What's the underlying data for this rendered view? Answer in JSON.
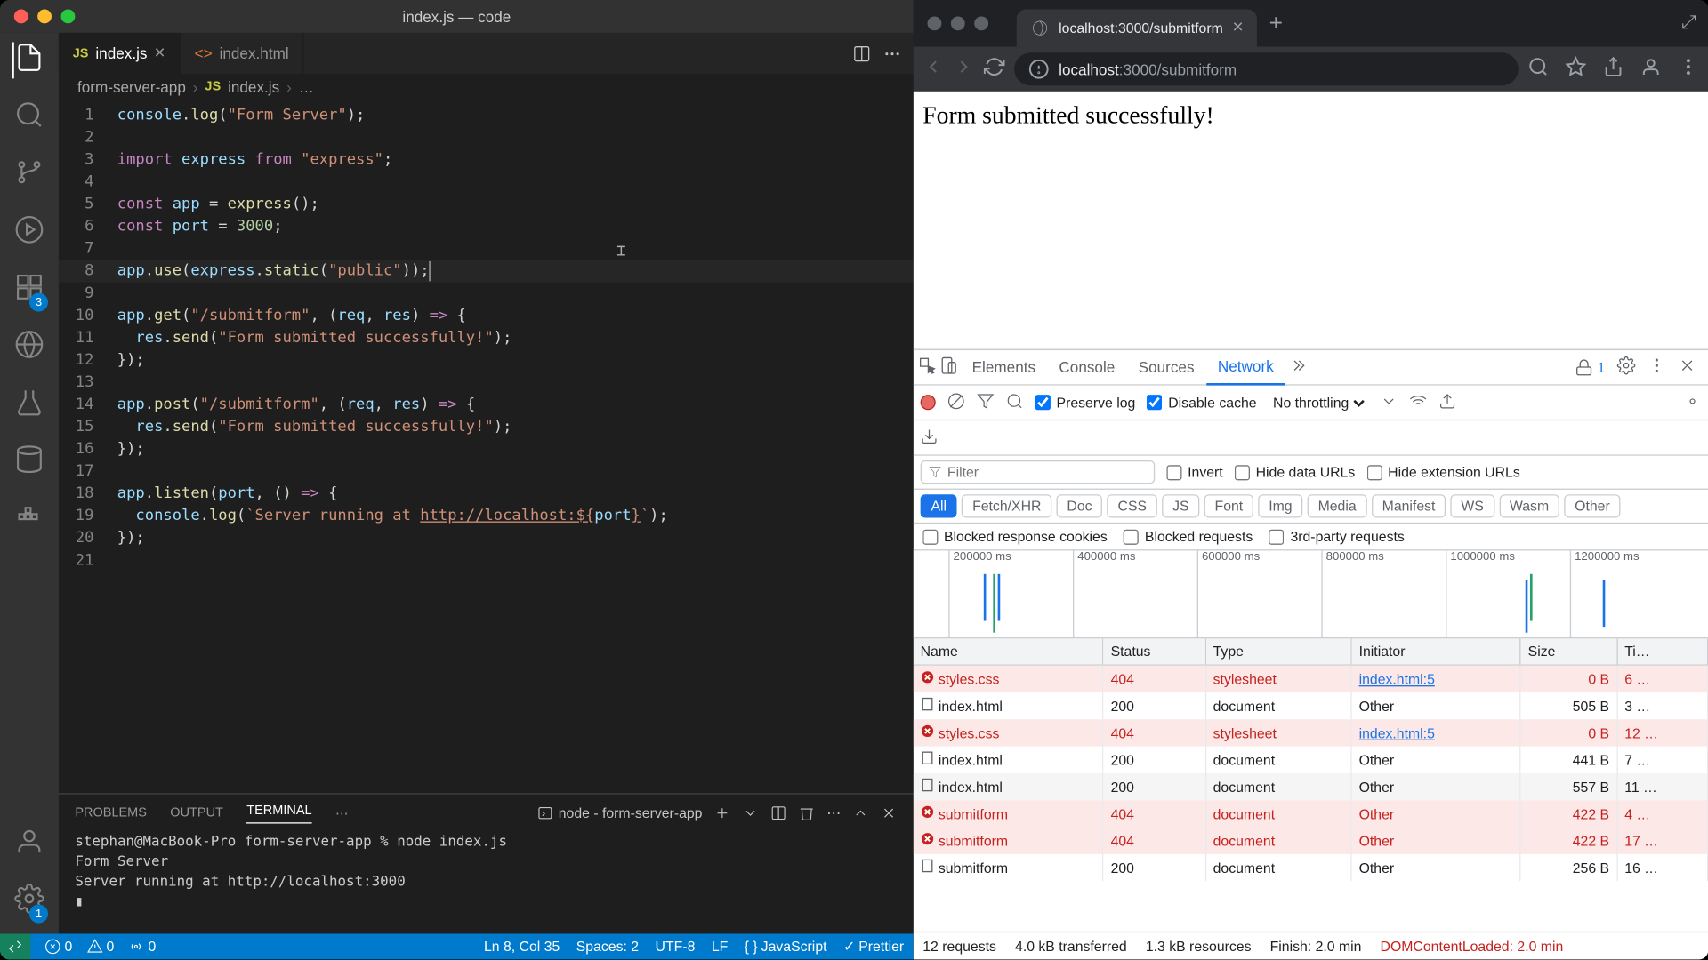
{
  "vscode": {
    "title": "index.js — code",
    "tabs": [
      {
        "icon": "JS",
        "name": "index.js",
        "active": true,
        "close": true
      },
      {
        "icon": "<>",
        "name": "index.html",
        "active": false,
        "close": false
      }
    ],
    "breadcrumbs": {
      "folder": "form-server-app",
      "file_icon": "JS",
      "file": "index.js",
      "member": "…"
    },
    "code_lines": [
      {
        "n": 1,
        "html": "<span class='id'>console</span>.<span class='fn'>log</span>(<span class='str'>\"Form Server\"</span>);"
      },
      {
        "n": 2,
        "html": ""
      },
      {
        "n": 3,
        "html": "<span class='kw'>import</span> <span class='id'>express</span> <span class='kw'>from</span> <span class='str'>\"express\"</span>;"
      },
      {
        "n": 4,
        "html": ""
      },
      {
        "n": 5,
        "html": "<span class='kw'>const</span> <span class='id'>app</span> = <span class='fn'>express</span>();"
      },
      {
        "n": 6,
        "html": "<span class='kw'>const</span> <span class='id'>port</span> = <span class='num'>3000</span>;"
      },
      {
        "n": 7,
        "html": ""
      },
      {
        "n": 8,
        "html": "<span class='id'>app</span>.<span class='fn'>use</span>(<span class='id'>express</span>.<span class='fn'>static</span>(<span class='str'>\"public\"</span>));",
        "current": true
      },
      {
        "n": 9,
        "html": ""
      },
      {
        "n": 10,
        "html": "<span class='id'>app</span>.<span class='fn'>get</span>(<span class='str'>\"/submitform\"</span>, (<span class='id'>req</span>, <span class='id'>res</span>) <span class='kw'>=&gt;</span> {"
      },
      {
        "n": 11,
        "html": "  <span class='id'>res</span>.<span class='fn'>send</span>(<span class='str'>\"Form submitted successfully!\"</span>);"
      },
      {
        "n": 12,
        "html": "});"
      },
      {
        "n": 13,
        "html": ""
      },
      {
        "n": 14,
        "html": "<span class='id'>app</span>.<span class='fn'>post</span>(<span class='str'>\"/submitform\"</span>, (<span class='id'>req</span>, <span class='id'>res</span>) <span class='kw'>=&gt;</span> {"
      },
      {
        "n": 15,
        "html": "  <span class='id'>res</span>.<span class='fn'>send</span>(<span class='str'>\"Form submitted successfully!\"</span>);"
      },
      {
        "n": 16,
        "html": "});"
      },
      {
        "n": 17,
        "html": ""
      },
      {
        "n": 18,
        "html": "<span class='id'>app</span>.<span class='fn'>listen</span>(<span class='id'>port</span>, () <span class='kw'>=&gt;</span> {"
      },
      {
        "n": 19,
        "html": "  <span class='id'>console</span>.<span class='fn'>log</span>(<span class='str'>`Server running at <span class='url'>http://localhost:${</span></span><span class='id'>port</span><span class='str'><span class='url'>}</span>`</span>);"
      },
      {
        "n": 20,
        "html": "});"
      },
      {
        "n": 21,
        "html": ""
      }
    ],
    "activitybar_badges": {
      "scm": "3",
      "settings": "1"
    },
    "panel": {
      "tabs": [
        "PROBLEMS",
        "OUTPUT",
        "TERMINAL"
      ],
      "active_tab": "TERMINAL",
      "terminal_select": "node - form-server-app",
      "terminal_content": "stephan@MacBook-Pro form-server-app % node index.js\nForm Server\nServer running at http://localhost:3000\n▮"
    },
    "statusbar": {
      "errors": "0",
      "warnings": "0",
      "ports": "0",
      "cursor": "Ln 8, Col 35",
      "spaces": "Spaces: 2",
      "encoding": "UTF-8",
      "eol": "LF",
      "lang": "JavaScript",
      "prettier": "Prettier"
    }
  },
  "browser": {
    "tab_title": "localhost:3000/submitform",
    "url_prefix": "localhost",
    "url_rest": ":3000/submitform",
    "page_text": "Form submitted successfully!"
  },
  "devtools": {
    "tabs": [
      "Elements",
      "Console",
      "Sources",
      "Network"
    ],
    "active_tab": "Network",
    "issue_count": "1",
    "toolbar": {
      "preserve_log": "Preserve log",
      "disable_cache": "Disable cache",
      "throttling": "No throttling"
    },
    "filter_placeholder": "Filter",
    "invert": "Invert",
    "hide_data": "Hide data URLs",
    "hide_ext": "Hide extension URLs",
    "chips": [
      "All",
      "Fetch/XHR",
      "Doc",
      "CSS",
      "JS",
      "Font",
      "Img",
      "Media",
      "Manifest",
      "WS",
      "Wasm",
      "Other"
    ],
    "active_chip": "All",
    "checks2": [
      "Blocked response cookies",
      "Blocked requests",
      "3rd-party requests"
    ],
    "timeline_ticks": [
      "200000 ms",
      "400000 ms",
      "600000 ms",
      "800000 ms",
      "1000000 ms",
      "1200000 ms"
    ],
    "columns": [
      "Name",
      "Status",
      "Type",
      "Initiator",
      "Size",
      "Ti…"
    ],
    "rows": [
      {
        "err": true,
        "name": "styles.css",
        "status": "404",
        "type": "stylesheet",
        "initiator": "index.html:5",
        "initiator_link": true,
        "size": "0 B",
        "time": "6 …"
      },
      {
        "err": false,
        "name": "index.html",
        "status": "200",
        "type": "document",
        "initiator": "Other",
        "size": "505 B",
        "time": "3 …"
      },
      {
        "err": true,
        "name": "styles.css",
        "status": "404",
        "type": "stylesheet",
        "initiator": "index.html:5",
        "initiator_link": true,
        "size": "0 B",
        "time": "12 …"
      },
      {
        "err": false,
        "name": "index.html",
        "status": "200",
        "type": "document",
        "initiator": "Other",
        "size": "441 B",
        "time": "7 …"
      },
      {
        "err": false,
        "name": "index.html",
        "status": "200",
        "type": "document",
        "initiator": "Other",
        "size": "557 B",
        "time": "11 …"
      },
      {
        "err": true,
        "name": "submitform",
        "status": "404",
        "type": "document",
        "initiator": "Other",
        "size": "422 B",
        "time": "4 …"
      },
      {
        "err": true,
        "name": "submitform",
        "status": "404",
        "type": "document",
        "initiator": "Other",
        "size": "422 B",
        "time": "17 …"
      },
      {
        "err": false,
        "name": "submitform",
        "status": "200",
        "type": "document",
        "initiator": "Other",
        "size": "256 B",
        "time": "16 …"
      }
    ],
    "summary": {
      "requests": "12 requests",
      "transferred": "4.0 kB transferred",
      "resources": "1.3 kB resources",
      "finish": "Finish: 2.0 min",
      "dom": "DOMContentLoaded: 2.0 min"
    }
  }
}
